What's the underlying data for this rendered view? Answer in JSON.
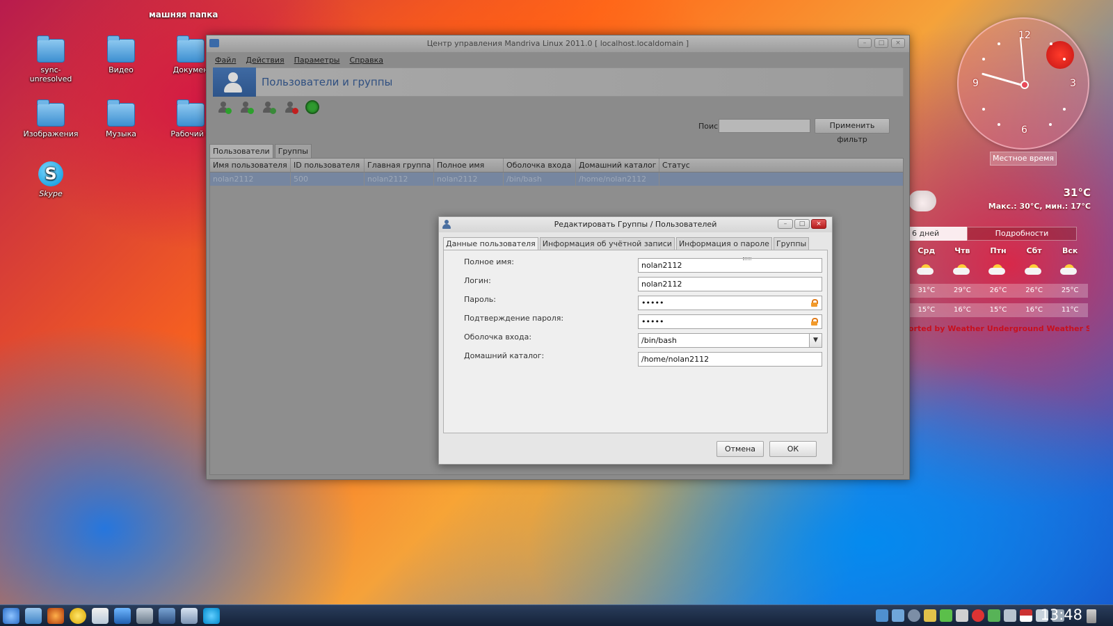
{
  "desktop": {
    "path_label": "машняя папка",
    "icons": [
      {
        "label": "sync-\nunresolved",
        "kind": "folder"
      },
      {
        "label": "Видео",
        "kind": "folder"
      },
      {
        "label": "Докумен",
        "kind": "folder"
      },
      {
        "label": "Изображения",
        "kind": "folder"
      },
      {
        "label": "Музыка",
        "kind": "folder"
      },
      {
        "label": "Рабочий с",
        "kind": "folder"
      },
      {
        "label": "Skype",
        "kind": "skype"
      }
    ]
  },
  "main_window": {
    "title": "Центр управления Mandriva Linux 2011.0 [ localhost.localdomain ]",
    "menu": [
      "Файл",
      "Действия",
      "Параметры",
      "Справка"
    ],
    "banner_title": "Пользователи и группы",
    "toolbar_icons": [
      "add-user-icon",
      "add-group-icon",
      "edit-user-icon",
      "delete-user-icon",
      "refresh-icon"
    ],
    "search_label": "Поиск:",
    "search_value": "",
    "filter_button": "Применить фильтр",
    "tabs": [
      "Пользователи",
      "Группы"
    ],
    "columns": [
      "Имя пользователя",
      "ID пользователя",
      "Главная группа",
      "Полное имя",
      "Оболочка входа",
      "Домашний каталог",
      "Статус"
    ],
    "rows": [
      [
        "nolan2112",
        "500",
        "nolan2112",
        "nolan2112",
        "/bin/bash",
        "/home/nolan2112",
        ""
      ]
    ]
  },
  "dialog": {
    "title": "Редактировать Группы / Пользователей",
    "tabs": [
      "Данные пользователя",
      "Информация об учётной записи",
      "Информация о пароле",
      "Группы"
    ],
    "fields": {
      "fullname": {
        "label": "Полное имя:",
        "value": "nolan2112"
      },
      "login": {
        "label": "Логин:",
        "value": "nolan2112"
      },
      "password": {
        "label": "Пароль:",
        "value": "•••••"
      },
      "password_confirm": {
        "label": "Подтверждение пароля:",
        "value": "•••••"
      },
      "shell": {
        "label": "Оболочка входа:",
        "value": "/bin/bash"
      },
      "home": {
        "label": "Домашний каталог:",
        "value": "/home/nolan2112"
      }
    },
    "cancel": "Отмена",
    "ok": "ОК"
  },
  "clock": {
    "numbers": [
      "12",
      "3",
      "6",
      "9"
    ],
    "label": "Местное время"
  },
  "weather": {
    "current": "31°C",
    "minmax": "Макс.: 30°C, мин.: 17°C",
    "tab_days": "6 дней",
    "tab_details": "Подробности",
    "days": [
      "Срд",
      "Чтв",
      "Птн",
      "Сбт",
      "Вск"
    ],
    "highs": [
      "31°C",
      "29°C",
      "26°C",
      "26°C",
      "25°C"
    ],
    "lows": [
      "15°C",
      "16°C",
      "15°C",
      "16°C",
      "11°C"
    ],
    "credit": "orted by Weather Underground Weather Static"
  },
  "taskbar": {
    "time": "13:48"
  }
}
